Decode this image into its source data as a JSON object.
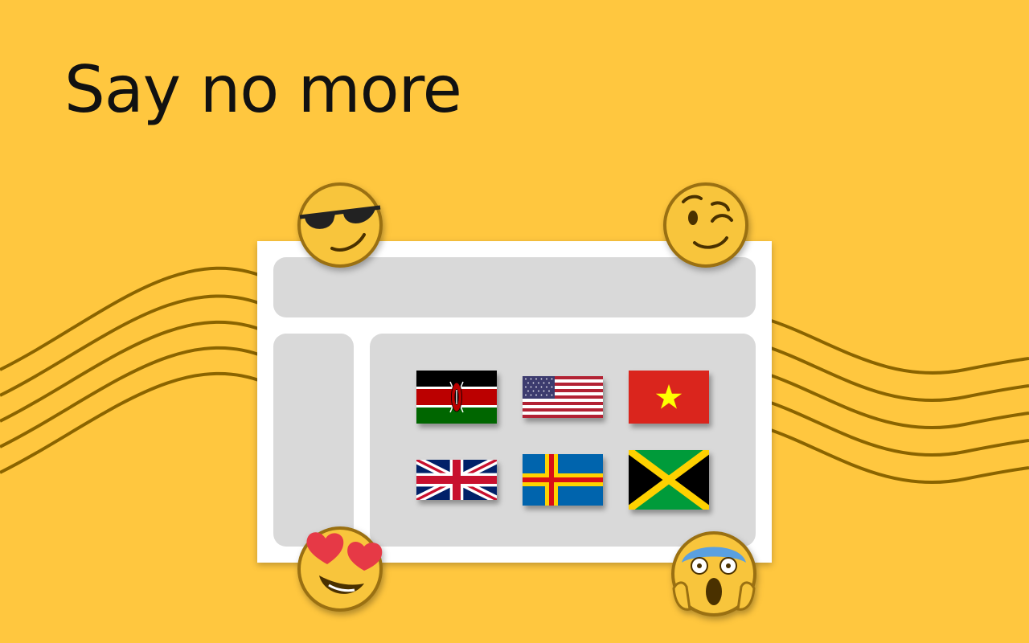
{
  "headline": "Say no more",
  "colors": {
    "background": "#ffc73f",
    "wave": "#8a6400",
    "window": "#ffffff",
    "panel": "#d9d9d9",
    "emoji_face": "#f8c53c",
    "emoji_outline": "#9a7012"
  },
  "flags": [
    {
      "country": "kenya"
    },
    {
      "country": "united-states"
    },
    {
      "country": "vietnam"
    },
    {
      "country": "united-kingdom"
    },
    {
      "country": "aland"
    },
    {
      "country": "jamaica"
    }
  ],
  "emojis": [
    {
      "icon": "sunglasses-face-icon"
    },
    {
      "icon": "winking-face-icon"
    },
    {
      "icon": "heart-eyes-face-icon"
    },
    {
      "icon": "screaming-face-icon"
    }
  ]
}
